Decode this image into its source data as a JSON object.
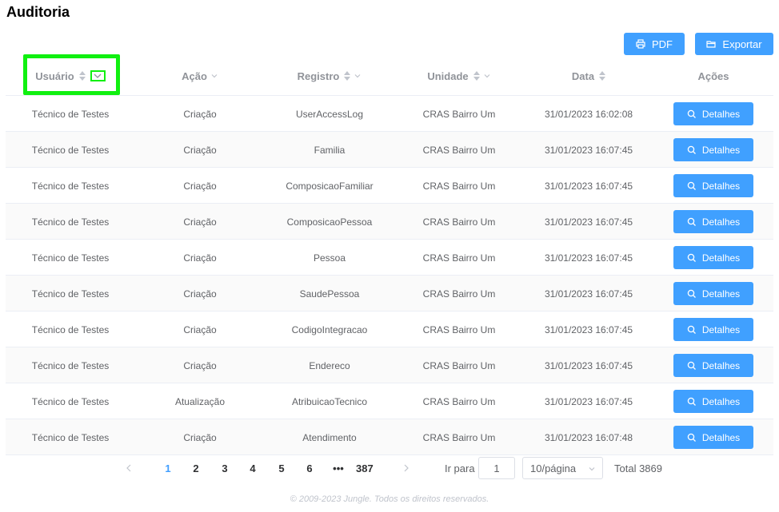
{
  "page": {
    "title": "Auditoria"
  },
  "toolbar": {
    "pdf_label": "PDF",
    "export_label": "Exportar"
  },
  "columns": {
    "usuario": "Usuário",
    "acao": "Ação",
    "registro": "Registro",
    "unidade": "Unidade",
    "data": "Data",
    "acoes": "Ações"
  },
  "rows": [
    {
      "usuario": "Técnico de Testes",
      "acao": "Criação",
      "registro": "UserAccessLog",
      "unidade": "CRAS Bairro Um",
      "data": "31/01/2023 16:02:08",
      "action": "Detalhes"
    },
    {
      "usuario": "Técnico de Testes",
      "acao": "Criação",
      "registro": "Familia",
      "unidade": "CRAS Bairro Um",
      "data": "31/01/2023 16:07:45",
      "action": "Detalhes"
    },
    {
      "usuario": "Técnico de Testes",
      "acao": "Criação",
      "registro": "ComposicaoFamiliar",
      "unidade": "CRAS Bairro Um",
      "data": "31/01/2023 16:07:45",
      "action": "Detalhes"
    },
    {
      "usuario": "Técnico de Testes",
      "acao": "Criação",
      "registro": "ComposicaoPessoa",
      "unidade": "CRAS Bairro Um",
      "data": "31/01/2023 16:07:45",
      "action": "Detalhes"
    },
    {
      "usuario": "Técnico de Testes",
      "acao": "Criação",
      "registro": "Pessoa",
      "unidade": "CRAS Bairro Um",
      "data": "31/01/2023 16:07:45",
      "action": "Detalhes"
    },
    {
      "usuario": "Técnico de Testes",
      "acao": "Criação",
      "registro": "SaudePessoa",
      "unidade": "CRAS Bairro Um",
      "data": "31/01/2023 16:07:45",
      "action": "Detalhes"
    },
    {
      "usuario": "Técnico de Testes",
      "acao": "Criação",
      "registro": "CodigoIntegracao",
      "unidade": "CRAS Bairro Um",
      "data": "31/01/2023 16:07:45",
      "action": "Detalhes"
    },
    {
      "usuario": "Técnico de Testes",
      "acao": "Criação",
      "registro": "Endereco",
      "unidade": "CRAS Bairro Um",
      "data": "31/01/2023 16:07:45",
      "action": "Detalhes"
    },
    {
      "usuario": "Técnico de Testes",
      "acao": "Atualização",
      "registro": "AtribuicaoTecnico",
      "unidade": "CRAS Bairro Um",
      "data": "31/01/2023 16:07:45",
      "action": "Detalhes"
    },
    {
      "usuario": "Técnico de Testes",
      "acao": "Criação",
      "registro": "Atendimento",
      "unidade": "CRAS Bairro Um",
      "data": "31/01/2023 16:07:48",
      "action": "Detalhes"
    }
  ],
  "pagination": {
    "prev_icon": "chevron-left-icon",
    "next_icon": "chevron-right-icon",
    "pages": [
      "1",
      "2",
      "3",
      "4",
      "5",
      "6"
    ],
    "ellipsis": "•••",
    "last_page": "387",
    "active_page": "1",
    "goto_label": "Ir para",
    "goto_value": "1",
    "page_size": "10/página",
    "total": "Total 3869"
  },
  "footer": {
    "text": "© 2009-2023 Jungle. Todos os direitos reservados."
  },
  "colors": {
    "accent": "#40a0ff",
    "highlight": "#10f010"
  }
}
